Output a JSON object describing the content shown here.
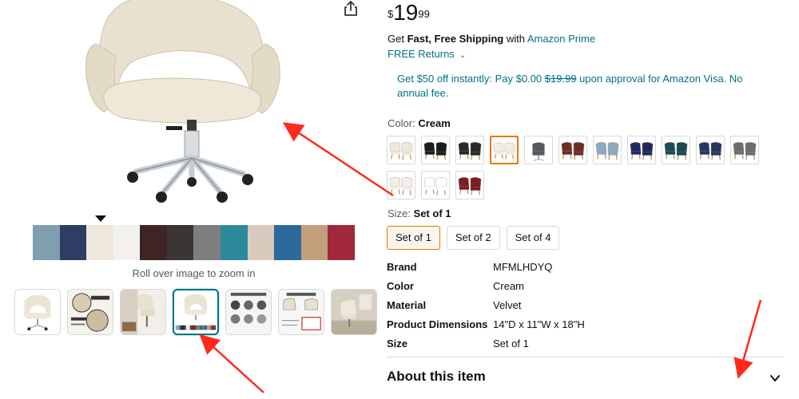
{
  "product": {
    "zoom_hint": "Roll over image to zoom in",
    "strip_colors": [
      "#7f9fb1",
      "#2f3d64",
      "#eee8dc",
      "#f3f1ec",
      "#3d2523",
      "#3b3534",
      "#7e7e7e",
      "#2d8a9c",
      "#d8cbbd",
      "#2c6a9c",
      "#c29f7b",
      "#a0283a"
    ],
    "thumbnails": [
      {
        "name": "chair-front"
      },
      {
        "name": "velvet-fabric-detail"
      },
      {
        "name": "chair-in-office"
      },
      {
        "name": "color-options"
      },
      {
        "name": "swatch-chart"
      },
      {
        "name": "measurement-chart"
      },
      {
        "name": "room-scene"
      }
    ]
  },
  "buybox": {
    "price_symbol": "$",
    "price_whole": "19",
    "price_fraction": "99",
    "shipping_prefix": "Get ",
    "shipping_bold": "Fast, Free Shipping",
    "shipping_middle": " with ",
    "shipping_link": "Amazon Prime",
    "returns_label": "FREE Returns",
    "promo_part1": "Get $50 off instantly: Pay $0.00 ",
    "promo_strike": "$19.99",
    "promo_part2": " upon approval for Amazon Visa. No annual fee."
  },
  "color_selector": {
    "label": "Color:",
    "selected": "Cream",
    "options": [
      {
        "color": "#efe7d8"
      },
      {
        "color": "#1d1d1d"
      },
      {
        "color": "#2a2a2a"
      },
      {
        "color": "#f1ece2"
      },
      {
        "color": "#555a5e"
      },
      {
        "color": "#6b2f22"
      },
      {
        "color": "#8fa9bd"
      },
      {
        "color": "#1f2a5c"
      },
      {
        "color": "#1a4a52"
      },
      {
        "color": "#27375e"
      },
      {
        "color": "#6d6d6d"
      },
      {
        "color": "#f3eee6"
      },
      {
        "color": "#ffffff"
      },
      {
        "color": "#7d1c24"
      }
    ]
  },
  "size_selector": {
    "label": "Size:",
    "selected": "Set of 1",
    "options": [
      "Set of 1",
      "Set of 2",
      "Set of 4"
    ]
  },
  "specs": [
    {
      "key": "Brand",
      "value": "MFMLHDYQ"
    },
    {
      "key": "Color",
      "value": "Cream"
    },
    {
      "key": "Material",
      "value": "Velvet"
    },
    {
      "key": "Product Dimensions",
      "value": "14\"D x 11\"W x 18\"H"
    },
    {
      "key": "Size",
      "value": "Set of 1"
    }
  ],
  "about": {
    "title": "About this item"
  },
  "colors": {
    "link": "#007185",
    "selected_border": "#e77600",
    "annotation": "#ff2a1a"
  }
}
